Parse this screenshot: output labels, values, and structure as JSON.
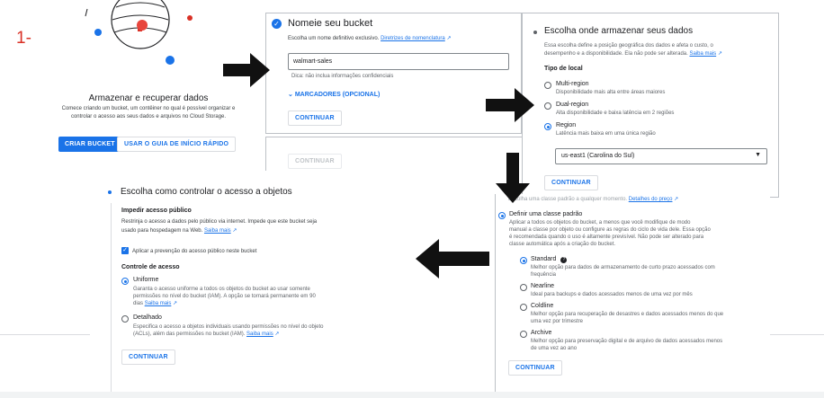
{
  "step_label": "1-",
  "panel1": {
    "title": "Armazenar e recuperar dados",
    "description_line1": "Comece criando um bucket, um contêiner no qual é possível organizar e",
    "description_line2": "controlar o acesso aos seus dados e arquivos no Cloud Storage.",
    "create_button": "CRIAR BUCKET",
    "guide_button": "USAR O GUIA DE INÍCIO RÁPIDO"
  },
  "panel2": {
    "title": "Nomeie seu bucket",
    "subtitle": "Escolha um nome definitivo exclusivo.",
    "guidelines_link": "Diretrizes de nomenclatura",
    "bucket_name_value": "walmart-sales",
    "hint": "Dica: não inclua informações confidenciais",
    "labels_toggle": "MARCADORES (OPCIONAL)",
    "continue_button": "CONTINUAR",
    "ghost_button": "CONTINUAR"
  },
  "panel3": {
    "title": "Escolha onde armazenar seus dados",
    "desc_line1": "Essa escolha define a posição geográfica dos dados e afeta o custo, o",
    "desc_line2": "desempenho e a disponibilidade. Ela não pode ser alterada.",
    "learn_more": "Saiba mais",
    "location_type_label": "Tipo de local",
    "options": [
      {
        "label": "Multi-region",
        "desc": "Disponibilidade mais alta entre áreas maiores",
        "selected": false
      },
      {
        "label": "Dual-region",
        "desc": "Alta disponibilidade e baixa latência em 2 regiões",
        "selected": false
      },
      {
        "label": "Region",
        "desc": "Latência mais baixa em uma única região",
        "selected": true
      }
    ],
    "region_value": "us-east1 (Carolina do Sul)",
    "continue_button": "CONTINUAR"
  },
  "panel4": {
    "top_text": "Escolha uma classe padrão a qualquer momento.",
    "top_link": "Detalhes do preço",
    "default_class_label": "Definir uma classe padrão",
    "default_desc_line1": "Aplicar a todos os objetos do bucket, a menos que você modifique de modo",
    "default_desc_line2": "manual a classe por objeto ou configure as regras do ciclo de vida dele. Essa opção",
    "default_desc_line3": "é recomendada quando o uso é altamente previsível. Não pode ser alterado para",
    "default_desc_line4": "classe automática após a criação do bucket.",
    "classes": [
      {
        "label": "Standard",
        "desc1": "Melhor opção para dados de armazenamento de curto prazo acessados com",
        "desc2": "frequência",
        "selected": true
      },
      {
        "label": "Nearline",
        "desc1": "Ideal para backups e dados acessados menos de uma vez por mês",
        "desc2": "",
        "selected": false
      },
      {
        "label": "Coldline",
        "desc1": "Melhor opção para recuperação de desastres e dados acessados menos do que",
        "desc2": "uma vez por trimestre",
        "selected": false
      },
      {
        "label": "Archive",
        "desc1": "Melhor opção para preservação digital e de arquivo de dados acessados menos",
        "desc2": "de uma vez ao ano",
        "selected": false
      }
    ],
    "continue_button": "CONTINUAR"
  },
  "panel5": {
    "title": "Escolha como controlar o acesso a objetos",
    "public_access_label": "Impedir acesso público",
    "public_desc_line1": "Restrinja o acesso a dados pelo público via internet. Impede que este bucket seja",
    "public_desc_line2": "usado para hospedagem na Web.",
    "learn_more": "Saiba mais",
    "checkbox_label": "Aplicar a prevenção do acesso público neste bucket",
    "access_control_label": "Controle de acesso",
    "uniform_label": "Uniforme",
    "uniform_desc1": "Garanta o acesso uniforme a todos os objetos do bucket ao usar somente",
    "uniform_desc2": "permissões no nível do bucket (IAM). A opção se tornará permanente em 90",
    "uniform_desc3": "dias",
    "fine_label": "Detalhado",
    "fine_desc1": "Especifica o acesso a objetos individuais usando permissões no nível do objeto",
    "fine_desc2": "(ACLs), além das permissões no bucket (IAM).",
    "continue_button": "CONTINUAR"
  },
  "colors": {
    "accent": "#1a73e8",
    "step": "#d93025",
    "arrow": "#111111"
  }
}
